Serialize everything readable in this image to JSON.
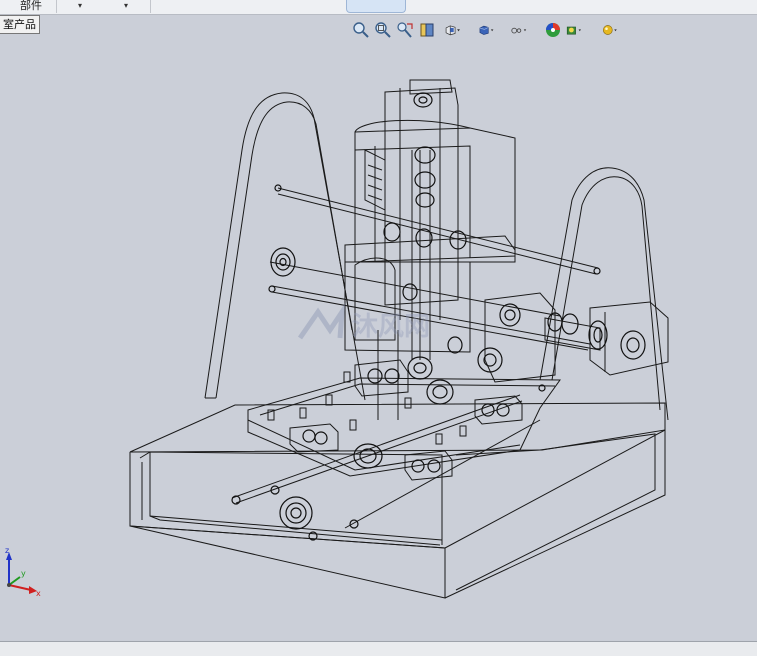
{
  "top_menu": {
    "item1": "部件",
    "item2_arrow": "▾",
    "item3_arrow": "▾"
  },
  "tree_tab": {
    "label": "室产品"
  },
  "view_toolbar": {
    "icons": [
      "zoom-to-fit-icon",
      "zoom-area-icon",
      "previous-view-icon",
      "section-view-icon",
      "view-orientation-icon",
      "display-style-icon",
      "hide-show-items-icon",
      "edit-appearance-icon",
      "apply-scene-icon",
      "view-settings-icon"
    ]
  },
  "triad": {
    "z": "z",
    "y": "y",
    "x": "x"
  },
  "watermark": {
    "text": "沐风网"
  },
  "colors": {
    "background": "#cbcfd8",
    "wire": "#1a1a1a",
    "triad_x": "#d02020",
    "triad_y": "#1f9a1f",
    "triad_z": "#2033c8"
  }
}
